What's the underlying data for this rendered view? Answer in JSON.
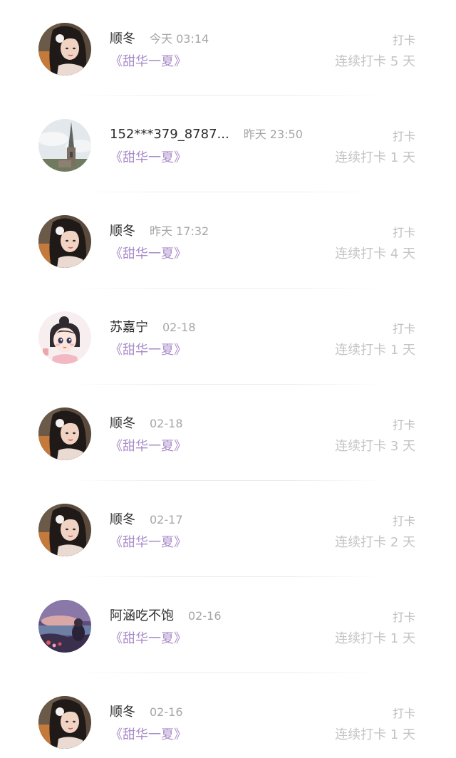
{
  "feed": {
    "items": [
      {
        "name": "顺冬",
        "time": "今天 03:14",
        "topic": "《甜华一夏》",
        "tag": "打卡",
        "streak": "连续打卡 5 天",
        "avatar": "avatar-girl-dark-hair"
      },
      {
        "name": "152***379_8787...",
        "time": "昨天 23:50",
        "topic": "《甜华一夏》",
        "tag": "打卡",
        "streak": "连续打卡 1 天",
        "avatar": "avatar-church-spire"
      },
      {
        "name": "顺冬",
        "time": "昨天 17:32",
        "topic": "《甜华一夏》",
        "tag": "打卡",
        "streak": "连续打卡 4 天",
        "avatar": "avatar-girl-dark-hair"
      },
      {
        "name": "苏嘉宁",
        "time": "02-18",
        "topic": "《甜华一夏》",
        "tag": "打卡",
        "streak": "连续打卡 1 天",
        "avatar": "avatar-cartoon-girl"
      },
      {
        "name": "顺冬",
        "time": "02-18",
        "topic": "《甜华一夏》",
        "tag": "打卡",
        "streak": "连续打卡 3 天",
        "avatar": "avatar-girl-dark-hair"
      },
      {
        "name": "顺冬",
        "time": "02-17",
        "topic": "《甜华一夏》",
        "tag": "打卡",
        "streak": "连续打卡 2 天",
        "avatar": "avatar-girl-dark-hair"
      },
      {
        "name": "阿涵吃不饱",
        "time": "02-16",
        "topic": "《甜华一夏》",
        "tag": "打卡",
        "streak": "连续打卡 1 天",
        "avatar": "avatar-sunset-landscape"
      },
      {
        "name": "顺冬",
        "time": "02-16",
        "topic": "《甜华一夏》",
        "tag": "打卡",
        "streak": "连续打卡 1 天",
        "avatar": "avatar-girl-dark-hair"
      }
    ]
  },
  "colors": {
    "name": "#2b2b2b",
    "time": "#a6a6a6",
    "topic": "#a98bc9",
    "tag": "#bdbdbd",
    "streak": "#c4c4c4"
  }
}
